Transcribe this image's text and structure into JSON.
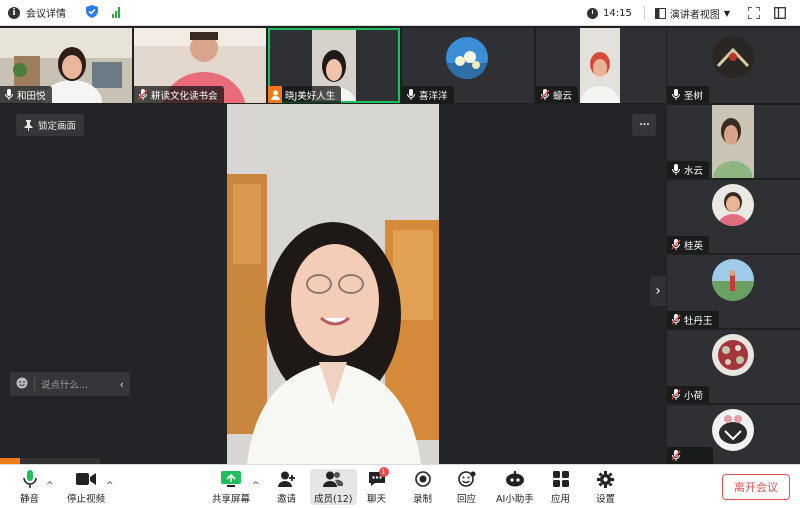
{
  "titlebar": {
    "title": "会议详情",
    "time": "14:15",
    "view_mode": "演讲者视图"
  },
  "thumbnails": [
    {
      "name": "和田悦",
      "mic": "on"
    },
    {
      "name": "耕读文化读书会",
      "mic": "muted"
    },
    {
      "name": "晓J美好人生",
      "mic": "host",
      "active": true
    },
    {
      "name": "喜洋洋",
      "mic": "on"
    },
    {
      "name": "蠔云",
      "mic": "muted"
    }
  ],
  "side_participants": [
    {
      "name": "圣树",
      "mic": "on"
    },
    {
      "name": "水云",
      "mic": "on"
    },
    {
      "name": "桂英",
      "mic": "muted"
    },
    {
      "name": "牡丹王",
      "mic": "muted"
    },
    {
      "name": "小荷",
      "mic": "muted"
    },
    {
      "name": "",
      "mic": "muted"
    }
  ],
  "main": {
    "lock_label": "锁定画面",
    "more_label": "···",
    "chat_placeholder": "说点什么..."
  },
  "toolbar": {
    "mute": "静音",
    "stop_video": "停止视频",
    "share": "共享屏幕",
    "invite": "邀请",
    "members": "成员(12)",
    "chat": "聊天",
    "chat_badge": "1",
    "record": "录制",
    "reaction": "回应",
    "ai": "AI小助手",
    "apps": "应用",
    "settings": "设置",
    "leave": "离开会议"
  },
  "colors": {
    "accent_green": "#1fbf5c",
    "leave_red": "#e05252",
    "host_orange": "#f07b16"
  }
}
